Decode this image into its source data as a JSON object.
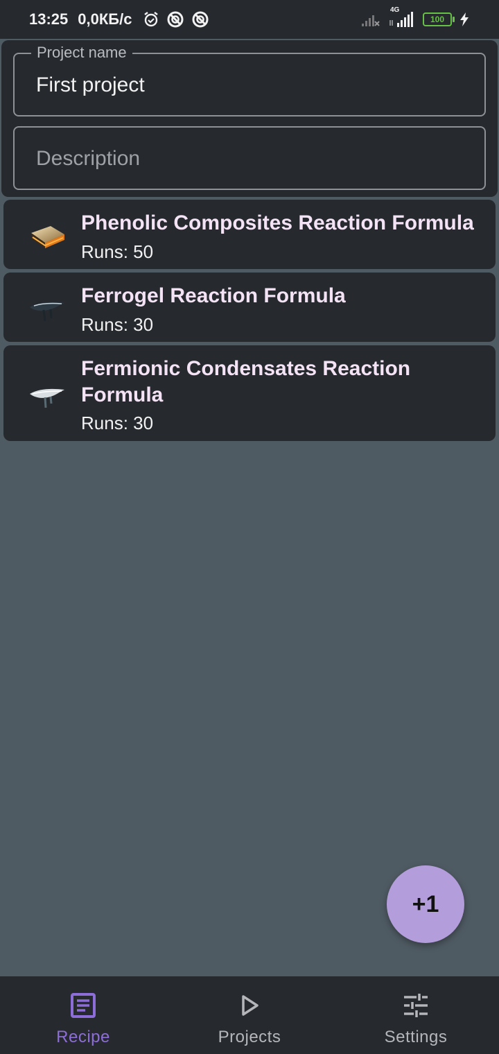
{
  "status_bar": {
    "time": "13:25",
    "net_speed": "0,0КБ/с",
    "left_icons": [
      "alarm-icon",
      "dnd-icon",
      "dnd-icon"
    ],
    "network": "4G",
    "battery": "100",
    "charging_icon": "bolt-icon"
  },
  "project": {
    "name_label": "Project name",
    "name_value": "First project",
    "description_placeholder": "Description"
  },
  "recipes": [
    {
      "title": "Phenolic Composites Reaction Formula",
      "runs": "Runs: 50",
      "icon": "phenolic-composites-icon"
    },
    {
      "title": "Ferrogel Reaction Formula",
      "runs": "Runs: 30",
      "icon": "ferrogel-icon"
    },
    {
      "title": "Fermionic Condensates Reaction Formula",
      "runs": "Runs: 30",
      "icon": "fermionic-condensates-icon"
    }
  ],
  "fab": {
    "label": "+1"
  },
  "bottom_nav": {
    "items": [
      {
        "label": "Recipe",
        "icon": "recipe-icon",
        "active": true
      },
      {
        "label": "Projects",
        "icon": "play-icon",
        "active": false
      },
      {
        "label": "Settings",
        "icon": "sliders-icon",
        "active": false
      }
    ]
  },
  "colors": {
    "background": "#4f5b63",
    "surface": "#26292e",
    "accent": "#8d6ed8",
    "fab": "#b39ddb",
    "title_text": "#f3e3f5",
    "battery": "#66c244"
  }
}
